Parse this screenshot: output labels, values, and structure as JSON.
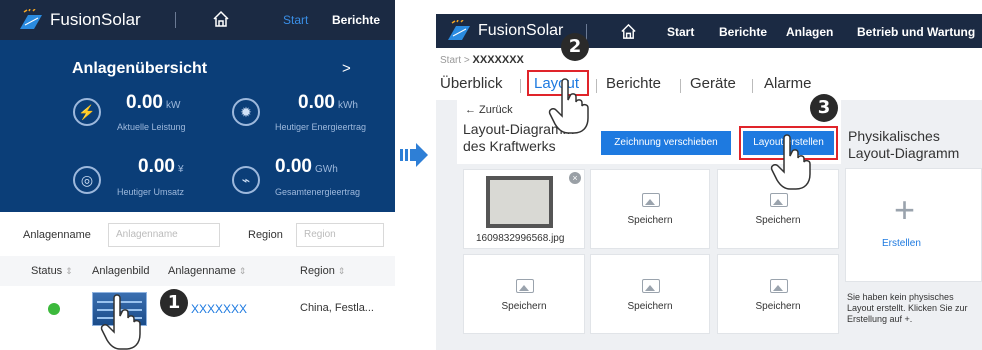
{
  "left": {
    "app_name": "FusionSolar",
    "nav": {
      "start": "Start",
      "berichte": "Berichte"
    },
    "overview_title": "Anlagenübersicht",
    "overview_chevron": ">",
    "stats": [
      {
        "value": "0.00",
        "unit": "kW",
        "label": "Aktuelle Leistung",
        "icon": "lightning-icon"
      },
      {
        "value": "0.00",
        "unit": "kWh",
        "label": "Heutiger Energieertrag",
        "icon": "sun-icon"
      },
      {
        "value": "0.00",
        "unit": "¥",
        "label": "Heutiger Umsatz",
        "icon": "coins-icon"
      },
      {
        "value": "0.00",
        "unit": "GWh",
        "label": "Gesamtenergieertrag",
        "icon": "chart-icon"
      }
    ],
    "filter": {
      "plant_name_label": "Anlagenname",
      "plant_name_placeholder": "Anlagenname",
      "region_label": "Region",
      "region_placeholder": "Region"
    },
    "table": {
      "headers": [
        "Status",
        "Anlagenbild",
        "Anlagenname",
        "Region"
      ],
      "row": {
        "plant_name": "XXXXXXX",
        "region": "China, Festla..."
      }
    },
    "step_badge": "1"
  },
  "right": {
    "app_name": "FusionSolar",
    "nav": [
      "Start",
      "Berichte",
      "Anlagen",
      "Betrieb und Wartung"
    ],
    "breadcrumb": {
      "root": "Start",
      "sep": ">",
      "current": "XXXXXXX"
    },
    "tabs": [
      "Überblick",
      "Layout",
      "Berichte",
      "Geräte",
      "Alarme"
    ],
    "back": "← Zurück",
    "layout_title_l1": "Layout-Diagramm",
    "layout_title_l2": "des Kraftwerks",
    "btn_move": "Zeichnung verschieben",
    "btn_create": "Layout erstellen",
    "phys_title_l1": "Physikalisches",
    "phys_title_l2": "Layout-Diagramm",
    "thumb_filename": "1609832996568.jpg",
    "cell_label": "Speichern",
    "create_label": "Erstellen",
    "create_plus": "+",
    "hint": "Sie haben kein physisches Layout erstellt. Klicken Sie zur Erstellung auf +.",
    "step_badges": [
      "2",
      "3"
    ]
  },
  "colors": {
    "nav_dark": "#1b2a43",
    "blue_panel": "#0b3e78",
    "accent": "#1e7ae0",
    "highlight_red": "#e0242a"
  }
}
